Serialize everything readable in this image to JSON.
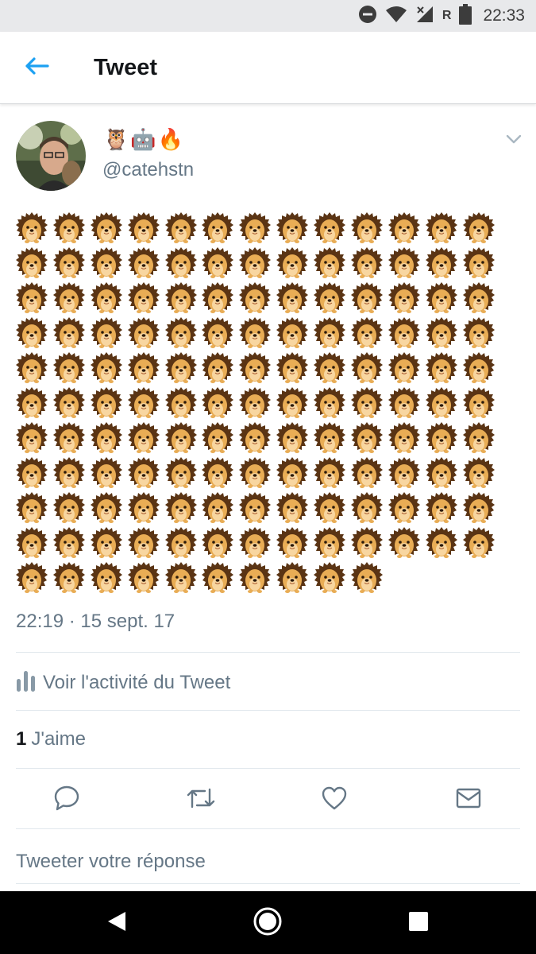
{
  "status_bar": {
    "time": "22:33",
    "network_label": "R",
    "icons": [
      "do-not-disturb-icon",
      "wifi-icon",
      "signal-icon",
      "battery-icon"
    ]
  },
  "app_bar": {
    "title": "Tweet",
    "back_icon": "arrow-left-icon",
    "accent_color": "#1da1f2"
  },
  "tweet": {
    "author_display_name": "🦉🤖🔥",
    "author_handle": "@catehstn",
    "body_emoji": "🦔",
    "body_emoji_count": 140,
    "timestamp": "22:19 · 15 sept. 17",
    "activity_label": "Voir l'activité du Tweet",
    "likes_count": "1",
    "likes_label": "J'aime",
    "actions": [
      "reply-icon",
      "retweet-icon",
      "like-icon",
      "direct-message-icon"
    ]
  },
  "reply": {
    "placeholder": "Tweeter votre réponse"
  },
  "nav_bar": {
    "buttons": [
      "back-triangle-icon",
      "home-circle-icon",
      "overview-square-icon"
    ]
  },
  "colors": {
    "text_primary": "#14171a",
    "text_secondary": "#657786",
    "divider": "#e1e8ed",
    "status_bar_bg": "#e8e9eb"
  }
}
